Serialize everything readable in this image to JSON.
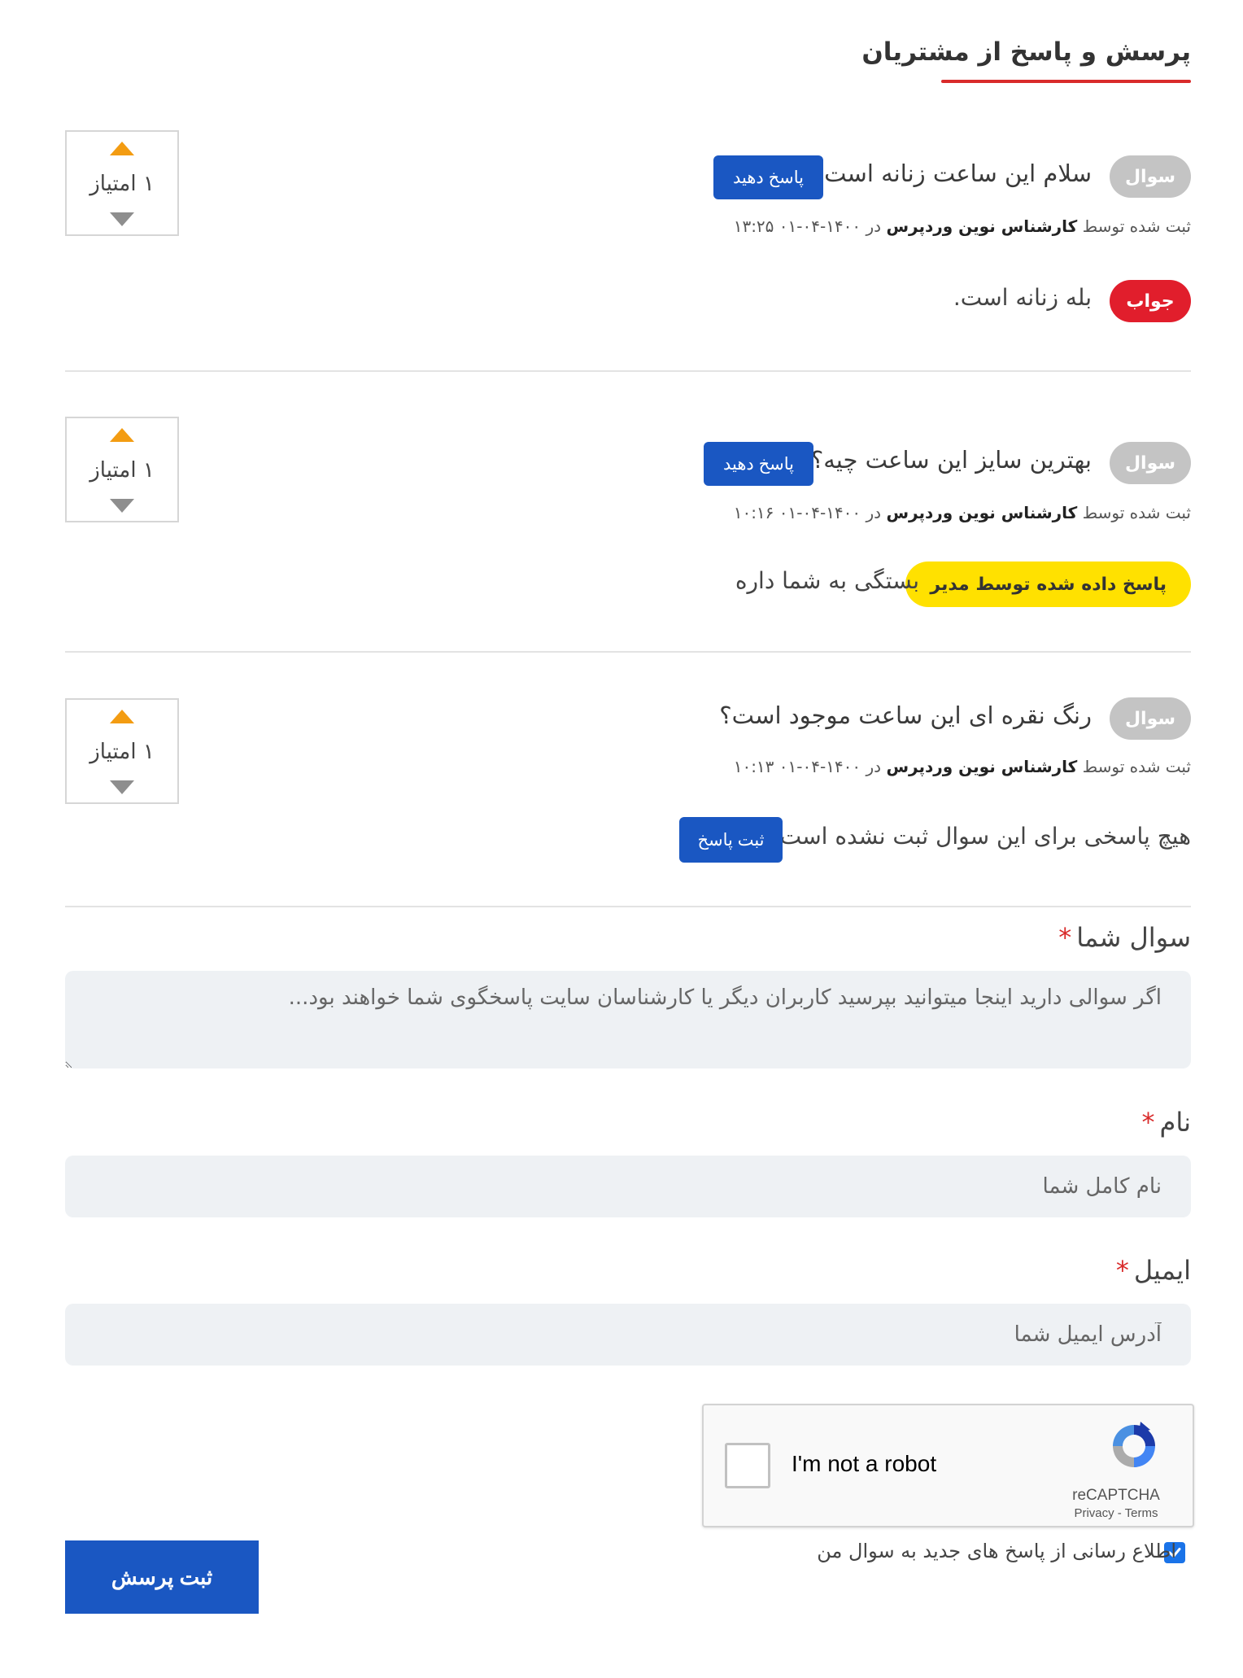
{
  "section": {
    "title": "پرسش و پاسخ از مشتریان"
  },
  "common": {
    "question_badge": "سوال",
    "score_label": "۱ امتیاز",
    "meta_prefix": "ثبت شده توسط",
    "meta_in": "در"
  },
  "questions": [
    {
      "text": "سلام این ساعت زنانه است؟",
      "action_label": "پاسخ دهید",
      "author": "کارشناس نوین وردپرس",
      "date": "۱۴۰۰-۰۴-۰۱ ۱۳:۲۵",
      "answer_badge": "جواب",
      "answer_text": "بله زنانه است."
    },
    {
      "text": "بهترین سایز این ساعت چیه؟",
      "action_label": "پاسخ دهید",
      "author": "کارشناس نوین وردپرس",
      "date": "۱۴۰۰-۰۴-۰۱ ۱۰:۱۶",
      "answer_badge": "پاسخ داده شده توسط مدیر",
      "answer_text": "بستگی به شما داره"
    },
    {
      "text": "رنگ نقره ای این ساعت موجود است؟",
      "author": "کارشناس نوین وردپرس",
      "date": "۱۴۰۰-۰۴-۰۱ ۱۰:۱۳",
      "no_answer_text": "هیچ پاسخی برای این سوال ثبت نشده است.",
      "action_label": "ثبت پاسخ"
    }
  ],
  "form": {
    "question_label": "سوال شما",
    "question_placeholder": "اگر سوالی دارید اینجا میتوانید بپرسید کاربران دیگر یا کارشناسان سایت پاسخگوی شما خواهند بود...",
    "name_label": "نام",
    "name_placeholder": "نام کامل شما",
    "email_label": "ایمیل",
    "email_placeholder": "آدرس ایمیل شما",
    "required_mark": "*",
    "recaptcha_label": "I'm not a robot",
    "recaptcha_brand": "reCAPTCHA",
    "recaptcha_links": "Privacy - Terms",
    "notify_label": "اطلاع رسانی از پاسخ های جدید به سوال من",
    "notify_checked": true,
    "submit_label": "ثبت پرسش"
  },
  "colors": {
    "accent_blue": "#1a57c2",
    "answer_red": "#e11e2c",
    "admin_yellow": "#ffe100",
    "title_underline": "#d92b2b",
    "vote_up": "#f39c12"
  }
}
